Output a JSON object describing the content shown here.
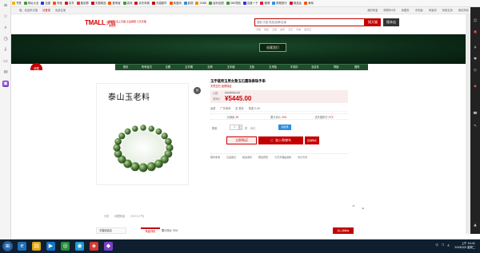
{
  "bookmarks": [
    {
      "label": "书签",
      "color": "#f0b400"
    },
    {
      "label": "网址大全",
      "color": "#3a9d2e"
    },
    {
      "label": "百度",
      "color": "#2932e1"
    },
    {
      "label": "淘宝",
      "color": "#ff5000"
    },
    {
      "label": "京东",
      "color": "#c81623"
    },
    {
      "label": "聚划算",
      "color": "#e4393c"
    },
    {
      "label": "天猫精选",
      "color": "#c40000"
    },
    {
      "label": "爱淘宝",
      "color": "#ff5000"
    },
    {
      "label": "游戏",
      "color": "#3a9d2e"
    },
    {
      "label": "京东商城",
      "color": "#c81623"
    },
    {
      "label": "天猫超市",
      "color": "#c40000"
    },
    {
      "label": "淘宝网",
      "color": "#ff5000"
    },
    {
      "label": "影视",
      "color": "#2b8fe0"
    },
    {
      "label": "3366",
      "color": "#f08c00"
    },
    {
      "label": "返利全国",
      "color": "#3a9d2e"
    },
    {
      "label": "360导航",
      "color": "#3a9d2e"
    },
    {
      "label": "百度一下",
      "color": "#2932e1"
    },
    {
      "label": "微博",
      "color": "#e6162d"
    },
    {
      "label": "携程旅行",
      "color": "#2b8fe0"
    },
    {
      "label": "唯品会",
      "color": "#c81623"
    },
    {
      "label": "海淘",
      "color": "#ff5000"
    }
  ],
  "site_nav": {
    "left": [
      "喵，欢迎来天猫",
      "请登录",
      "免费注册"
    ],
    "right": [
      "我的淘宝",
      "购物车0件",
      "收藏夹",
      "手机版",
      "淘宝网",
      "商家支持",
      "网站导航"
    ]
  },
  "header": {
    "logo": "TMALL",
    "logo_cn": "天猫",
    "slogan": "理想生活上天猫 正品保障 七天无理由退换",
    "search_placeholder": "搜索 天猫 商品/品牌/店铺",
    "search_button": "搜天猫",
    "shop_button": "搜本店",
    "hot_words": [
      "手镯",
      "项链",
      "玉佩",
      "翡翠",
      "玉石",
      "手串",
      "和田玉"
    ]
  },
  "banner": {
    "title": "收藏我们",
    "fav_badge": "收藏"
  },
  "shop_menu": [
    "首页",
    "所有宝贝",
    "玉镯",
    "玉手镯",
    "玉佩",
    "玉手链",
    "玉坠",
    "玉吊坠",
    "平安扣",
    "玉挂件",
    "项链",
    "摆件"
  ],
  "product": {
    "gallery_title": "泰山玉老料",
    "title": "玉手链男玉男女款玉石圆珠佛珠手串",
    "subtitle": "天然玉石 品质保证",
    "price_label": "价格",
    "original_price": "¥10800.00",
    "promo_label": "促销价",
    "promo_price": "¥5445.00",
    "ship_label": "运费",
    "ship_from": "广东深圳",
    "ship_to": "至 泰安",
    "ship_fee": "快递 0.00",
    "monthly_sales_label": "月销量",
    "monthly_sales": "29",
    "reviews_label": "累计评价",
    "reviews": "334",
    "points_label": "送天猫积分",
    "points": "272",
    "qty_label": "数量",
    "qty": "1",
    "qty_unit": "件",
    "qty_stock": "库存",
    "coupon_button": "领优惠",
    "buy_now": "立即购买",
    "add_cart": "加入购物车",
    "buy_in_shop": "店铺购买",
    "promises": [
      "服务承诺",
      "正品保证",
      "极速退款",
      "赠运费险",
      "七天无理由退换",
      "支付方式"
    ],
    "actions": [
      "分享",
      "收藏商品",
      "(3171人气)"
    ]
  },
  "tabs": {
    "shop": "天猫精选店",
    "detail": "商品详情",
    "review": "累计评价 334",
    "cart": "加入购物车"
  },
  "taskbar": {
    "time": "上午 10:41",
    "date": "2016/4/5 星期二",
    "tray": [
      "中",
      "❒",
      "◭"
    ]
  }
}
